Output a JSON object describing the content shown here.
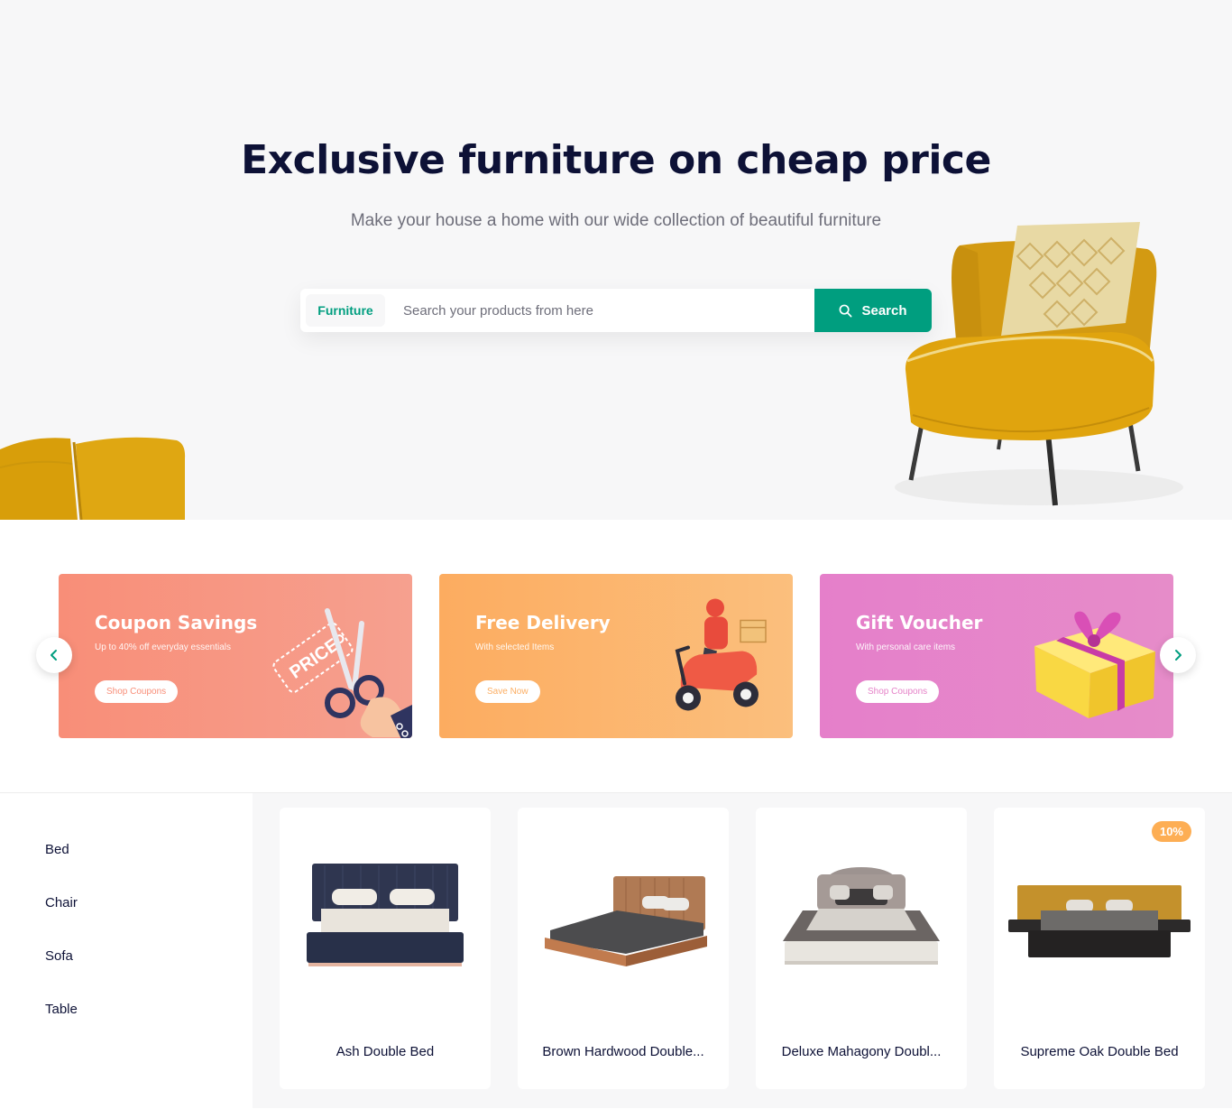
{
  "hero": {
    "title": "Exclusive furniture on cheap price",
    "subtitle": "Make your house a home with our wide collection of beautiful furniture",
    "search": {
      "category": "Furniture",
      "placeholder": "Search your products from here",
      "button_label": "Search",
      "button_icon": "search-icon"
    }
  },
  "offers": [
    {
      "title": "Coupon Savings",
      "description": "Up to 40% off everyday essentials",
      "button": "Shop Coupons",
      "color": "#f88e78",
      "art_label": "PRICE"
    },
    {
      "title": "Free Delivery",
      "description": "With selected Items",
      "button": "Save Now",
      "color": "#fcae63"
    },
    {
      "title": "Gift Voucher",
      "description": "With personal care items",
      "button": "Shop Coupons",
      "color": "#e582c8"
    }
  ],
  "carousel": {
    "prev_icon": "chevron-left-icon",
    "next_icon": "chevron-right-icon"
  },
  "categories": [
    "Bed",
    "Chair",
    "Sofa",
    "Table"
  ],
  "products": [
    {
      "name": "Ash Double Bed",
      "badge": ""
    },
    {
      "name": "Brown Hardwood Double...",
      "badge": ""
    },
    {
      "name": "Deluxe Mahagony Doubl...",
      "badge": ""
    },
    {
      "name": "Supreme Oak Double Bed",
      "badge": "10%"
    }
  ],
  "colors": {
    "primary": "#009e7f",
    "heading": "#0d1136",
    "badge": "#fdae54"
  }
}
